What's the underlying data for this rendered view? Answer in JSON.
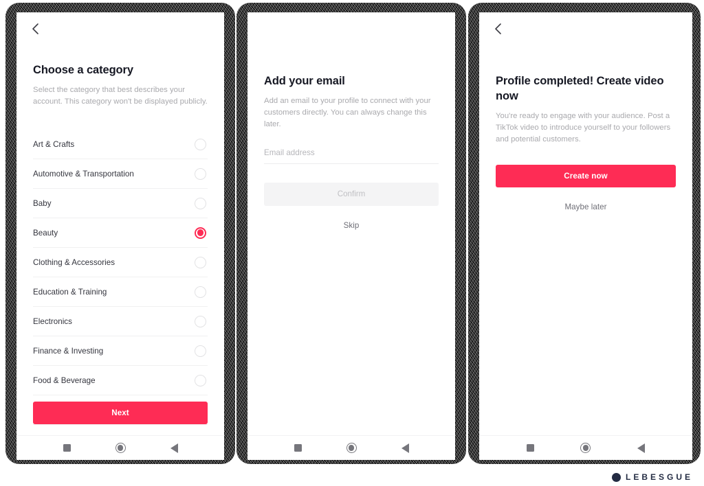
{
  "accent_color": "#FE2C55",
  "heading_color": "#161823",
  "muted_color": "#A9A9AD",
  "screens": [
    {
      "id": "choose-category",
      "back_icon": "chevron-left-icon",
      "title": "Choose a category",
      "subtitle": "Select the category that best describes your account. This category won't be displayed publicly.",
      "categories": [
        {
          "label": "Art & Crafts",
          "selected": false
        },
        {
          "label": "Automotive & Transportation",
          "selected": false
        },
        {
          "label": "Baby",
          "selected": false
        },
        {
          "label": "Beauty",
          "selected": true
        },
        {
          "label": "Clothing & Accessories",
          "selected": false
        },
        {
          "label": "Education & Training",
          "selected": false
        },
        {
          "label": "Electronics",
          "selected": false
        },
        {
          "label": "Finance & Investing",
          "selected": false
        },
        {
          "label": "Food & Beverage",
          "selected": false
        }
      ],
      "primary_button": "Next"
    },
    {
      "id": "add-your-email",
      "back_icon": null,
      "title": "Add your email",
      "subtitle": "Add an email to your profile to connect with your customers directly. You can always change this later.",
      "email_placeholder": "Email address",
      "email_value": "",
      "confirm_button": "Confirm",
      "confirm_enabled": false,
      "skip_button": "Skip"
    },
    {
      "id": "profile-completed",
      "back_icon": "chevron-left-icon",
      "title": "Profile completed! Create video now",
      "subtitle": "You're ready to engage with your audience. Post a TikTok video to introduce yourself to your followers and potential customers.",
      "primary_button": "Create now",
      "secondary_button": "Maybe later"
    }
  ],
  "navbar": {
    "recents_icon": "square-recents-icon",
    "home_icon": "circle-home-icon",
    "back_icon": "triangle-back-icon"
  },
  "watermark": {
    "text": "LEBESGUE",
    "mark_icon": "lebesgue-logo-icon"
  }
}
